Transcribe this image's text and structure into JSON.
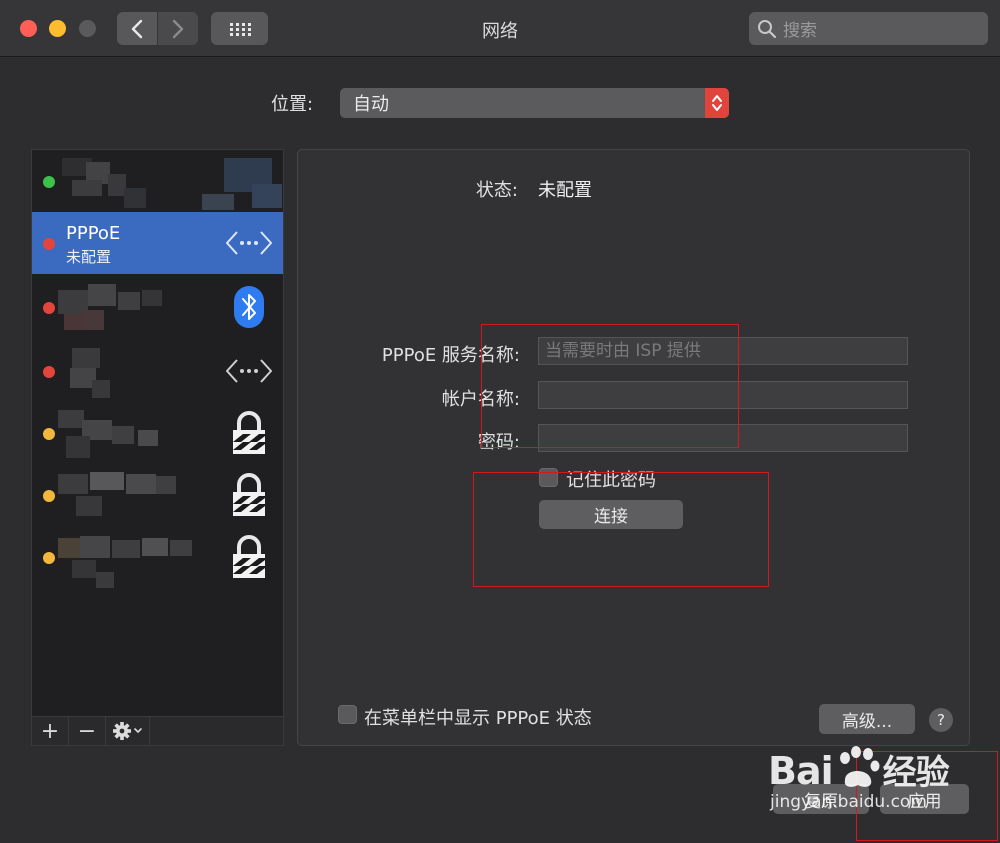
{
  "window": {
    "title": "网络"
  },
  "search": {
    "placeholder": "搜索"
  },
  "location": {
    "label": "位置:",
    "value": "自动"
  },
  "services": [
    {
      "name": "",
      "status": "",
      "dot_color": "#3ec14b",
      "icon": "none"
    },
    {
      "name": "PPPoE",
      "status": "未配置",
      "dot_color": "#e2453c",
      "icon": "ethernet-icon"
    },
    {
      "name": "",
      "status": "",
      "dot_color": "#e2453c",
      "icon": "bluetooth-icon"
    },
    {
      "name": "",
      "status": "",
      "dot_color": "#e2453c",
      "icon": "ethernet-icon"
    },
    {
      "name": "",
      "status": "",
      "dot_color": "#f3b83b",
      "icon": "vpn-lock-icon"
    },
    {
      "name": "",
      "status": "",
      "dot_color": "#f3b83b",
      "icon": "vpn-lock-icon"
    },
    {
      "name": "",
      "status": "",
      "dot_color": "#f3b83b",
      "icon": "vpn-lock-icon"
    }
  ],
  "sidebar_toolbar": {
    "add": "+",
    "remove": "−"
  },
  "detail": {
    "status_label": "状态:",
    "status_value": "未配置",
    "service_name_label": "PPPoE 服务名称:",
    "service_name_placeholder": "当需要时由 ISP 提供",
    "account_label": "帐户名称:",
    "account_value": "",
    "password_label": "密码:",
    "password_value": "",
    "remember_label": "记住此密码",
    "connect_label": "连接",
    "show_in_menubar_label": "在菜单栏中显示 PPPoE 状态",
    "advanced_label": "高级...",
    "help_label": "?"
  },
  "footer": {
    "revert_label": "复原",
    "apply_label": "应用"
  },
  "watermark": {
    "brand": "Bai  经验",
    "url": "jingyan.baidu.com"
  },
  "colors": {
    "accent": "#3b6bc0",
    "annotation": "#d11a1a"
  }
}
